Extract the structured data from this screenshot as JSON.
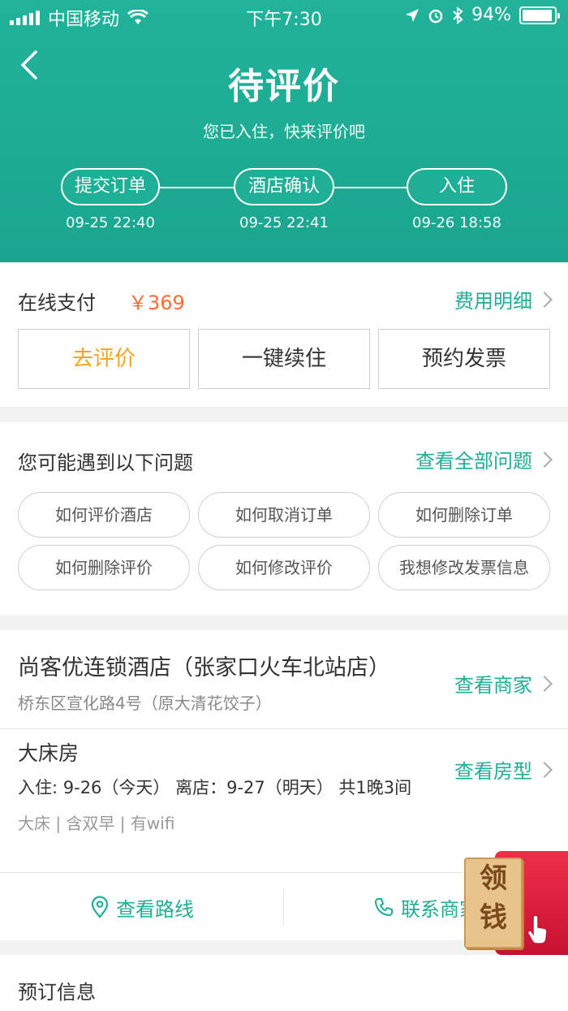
{
  "status_bar": {
    "carrier": "中国移动",
    "time": "下午7:30",
    "battery": "94%"
  },
  "header": {
    "title": "待评价",
    "subtitle": "您已入住，快来评价吧",
    "steps": [
      {
        "label": "提交订单",
        "time": "09-25 22:40"
      },
      {
        "label": "酒店确认",
        "time": "09-25 22:41"
      },
      {
        "label": "入住",
        "time": "09-26 18:58"
      }
    ]
  },
  "payment": {
    "label": "在线支付",
    "amount": "￥369",
    "detail_link": "费用明细",
    "buttons": {
      "review": "去评价",
      "extend": "一键续住",
      "invoice": "预约发票"
    }
  },
  "faq": {
    "title": "您可能遇到以下问题",
    "all_link": "查看全部问题",
    "chips": [
      "如何评价酒店",
      "如何取消订单",
      "如何删除订单",
      "如何删除评价",
      "如何修改评价",
      "我想修改发票信息"
    ]
  },
  "hotel": {
    "name": "尚客优连锁酒店（张家口火车北站店）",
    "address": "桥东区宣化路4号（原大清花饺子）",
    "merchant_link": "查看商家",
    "room_name": "大床房",
    "room_link": "查看房型",
    "dates": "入住: 9-26（今天）  离店：9-27（明天）  共1晚3间",
    "tags": "大床 | 含双早 | 有wifi",
    "route": "查看路线",
    "contact": "联系商家"
  },
  "booking": {
    "title": "预订信息"
  },
  "packet": {
    "line1": "领",
    "line2": "钱"
  },
  "colors": {
    "primary": "#1fae96",
    "price": "#ff6d34",
    "accent": "#f0a623"
  }
}
